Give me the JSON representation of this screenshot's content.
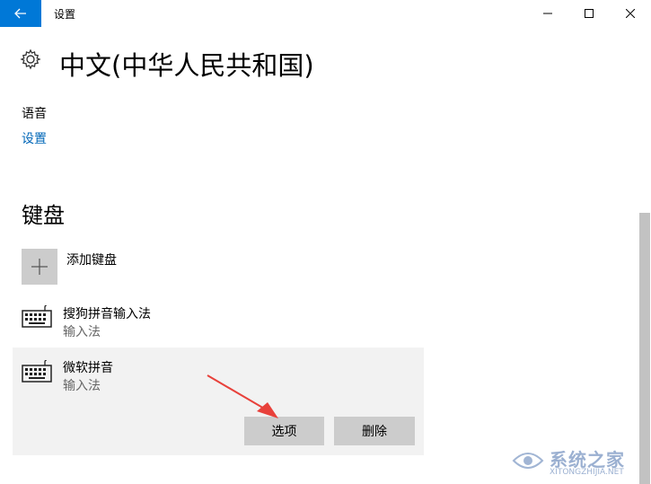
{
  "window": {
    "title": "设置",
    "accent_color": "#0078d7"
  },
  "page": {
    "title": "中文(中华人民共和国)"
  },
  "speech": {
    "label": "语音",
    "link": "设置"
  },
  "keyboards": {
    "heading": "键盘",
    "add_label": "添加键盘",
    "items": [
      {
        "name": "搜狗拼音输入法",
        "type": "输入法"
      },
      {
        "name": "微软拼音",
        "type": "输入法"
      }
    ],
    "options_label": "选项",
    "remove_label": "删除"
  },
  "watermark": {
    "text": "系统之家",
    "url": "XITONGZHIJIA.NET"
  },
  "colors": {
    "link": "#0067b8",
    "button_bg": "#cccccc",
    "panel_bg": "#f2f2f2",
    "arrow": "#e8413b"
  },
  "icons": [
    "back-arrow-icon",
    "minimize-icon",
    "maximize-icon",
    "close-icon",
    "gear-icon",
    "plus-icon",
    "keyboard-icon"
  ]
}
